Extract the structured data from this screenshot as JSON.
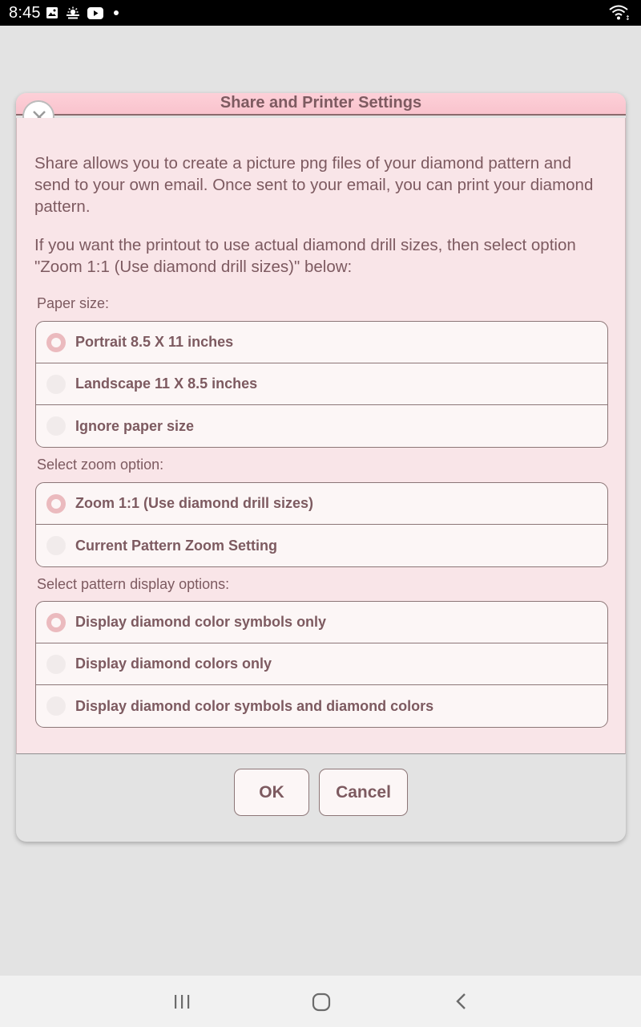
{
  "status_bar": {
    "time": "8:45",
    "icons": [
      "image-icon",
      "weather-icon",
      "youtube-icon",
      "notification-dot",
      "wifi-icon"
    ]
  },
  "dialog": {
    "title": "Share and Printer Settings",
    "intro_paragraph": "Share allows you to create a picture png files of your diamond pattern and send to your own email. Once sent to your email, you can print your diamond pattern.",
    "zoom_hint_paragraph": "If you want the printout to use actual diamond drill sizes, then select option \"Zoom 1:1 (Use diamond drill sizes)\" below:",
    "paper_size": {
      "label": "Paper size:",
      "options": [
        "Portrait 8.5 X 11 inches",
        "Landscape 11 X 8.5 inches",
        "Ignore paper size"
      ],
      "selected": "Portrait 8.5 X 11 inches"
    },
    "zoom": {
      "label": "Select zoom option:",
      "options": [
        "Zoom 1:1 (Use diamond drill sizes)",
        "Current Pattern Zoom Setting"
      ],
      "selected": "Zoom 1:1 (Use diamond drill sizes)"
    },
    "display": {
      "label": "Select pattern display options:",
      "options": [
        "Display diamond color symbols only",
        "Display diamond colors only",
        "Display diamond color symbols and diamond colors"
      ],
      "selected": "Display diamond color symbols only"
    },
    "buttons": {
      "ok": "OK",
      "cancel": "Cancel"
    }
  },
  "colors": {
    "title_bar": "#fdd0d8",
    "dialog_body": "#f9e5e8",
    "text": "#7d5a60",
    "radio_selected": "#ebbabe",
    "backdrop": "#e3e3e3"
  },
  "nav_bar": {
    "buttons": [
      "recent-apps-icon",
      "home-icon",
      "back-icon"
    ]
  }
}
